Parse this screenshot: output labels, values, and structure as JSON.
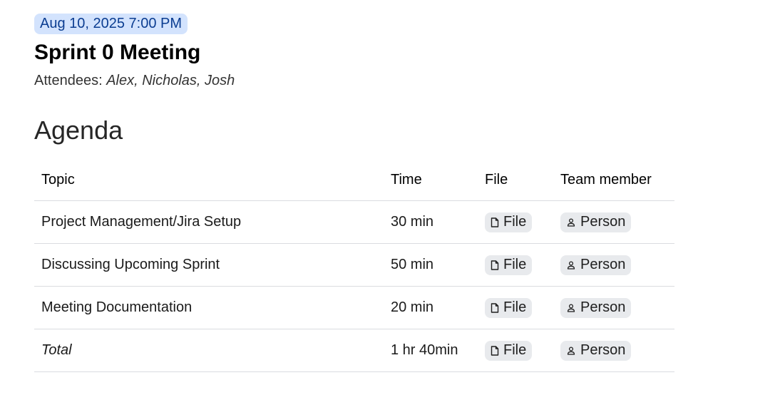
{
  "meeting": {
    "date_chip": "Aug 10, 2025 7:00 PM",
    "title": "Sprint 0 Meeting",
    "attendees_label": "Attendees: ",
    "attendees_names": "Alex, Nicholas, Josh"
  },
  "agenda": {
    "heading": "Agenda",
    "columns": [
      "Topic",
      "Time",
      "File",
      "Team member"
    ],
    "rows": [
      {
        "topic": "Project Management/Jira Setup",
        "time": "30 min",
        "file": "File",
        "person": "Person",
        "file_icon": "file-icon",
        "person_icon": "person-icon"
      },
      {
        "topic": "Discussing Upcoming Sprint",
        "time": "50 min",
        "file": "File",
        "person": "Person",
        "file_icon": "file-icon",
        "person_icon": "person-icon"
      },
      {
        "topic": "Meeting Documentation",
        "time": "20 min",
        "file": "File",
        "person": "Person",
        "file_icon": "file-icon",
        "person_icon": "person-icon"
      },
      {
        "topic": "Total",
        "time": "1 hr 40min",
        "file": "File",
        "person": "Person",
        "file_icon": "file-icon",
        "person_icon": "person-icon"
      }
    ]
  },
  "colors": {
    "date_chip_bg": "#d3e3fd",
    "date_chip_text": "#0b3d91",
    "smart_chip_bg": "#e8eaed",
    "row_divider": "#dadce0"
  }
}
